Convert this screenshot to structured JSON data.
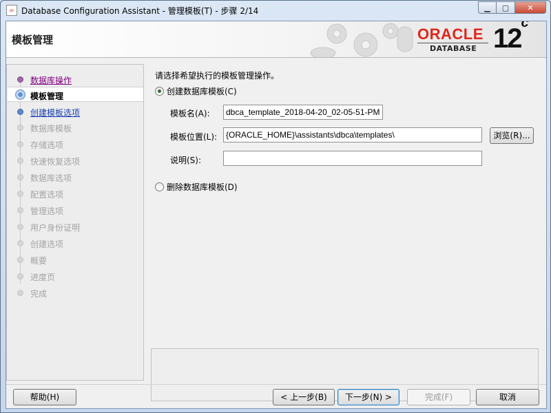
{
  "window": {
    "title": "Database Configuration Assistant - 管理模板(T) - 步骤 2/14",
    "buttons": {
      "minimize": "▁",
      "maximize": "▢",
      "close": "✕"
    }
  },
  "header": {
    "title": "模板管理",
    "logo_brand": "ORACLE",
    "logo_sub": "DATABASE",
    "version": "12",
    "version_suffix": "c"
  },
  "nav": {
    "items": [
      {
        "label": "数据库操作",
        "state": "visited"
      },
      {
        "label": "模板管理",
        "state": "current"
      },
      {
        "label": "创建模板选项",
        "state": "next"
      },
      {
        "label": "数据库模板",
        "state": "disabled"
      },
      {
        "label": "存储选项",
        "state": "disabled"
      },
      {
        "label": "快速恢复选项",
        "state": "disabled"
      },
      {
        "label": "数据库选项",
        "state": "disabled"
      },
      {
        "label": "配置选项",
        "state": "disabled"
      },
      {
        "label": "管理选项",
        "state": "disabled"
      },
      {
        "label": "用户身份证明",
        "state": "disabled"
      },
      {
        "label": "创建选项",
        "state": "disabled"
      },
      {
        "label": "概要",
        "state": "disabled"
      },
      {
        "label": "进度页",
        "state": "disabled"
      },
      {
        "label": "完成",
        "state": "disabled"
      }
    ]
  },
  "main": {
    "instruction": "请选择希望执行的模板管理操作。",
    "option_create": {
      "label": "创建数据库模板(C)",
      "selected": true
    },
    "template_name": {
      "label": "模板名(A):",
      "value": "dbca_template_2018-04-20_02-05-51-PM"
    },
    "template_location": {
      "label": "模板位置(L):",
      "value": "{ORACLE_HOME}\\assistants\\dbca\\templates\\"
    },
    "browse_button": "浏览(R)...",
    "description": {
      "label": "说明(S):",
      "value": ""
    },
    "option_delete": {
      "label": "删除数据库模板(D)",
      "selected": false
    }
  },
  "footer": {
    "help": "帮助(H)",
    "back": "< 上一步(B)",
    "next": "下一步(N) >",
    "finish": "完成(F)",
    "cancel": "取消"
  },
  "colors": {
    "oracle_red": "#e0261b",
    "visited_link": "#800080",
    "next_link": "#1a3fae"
  }
}
